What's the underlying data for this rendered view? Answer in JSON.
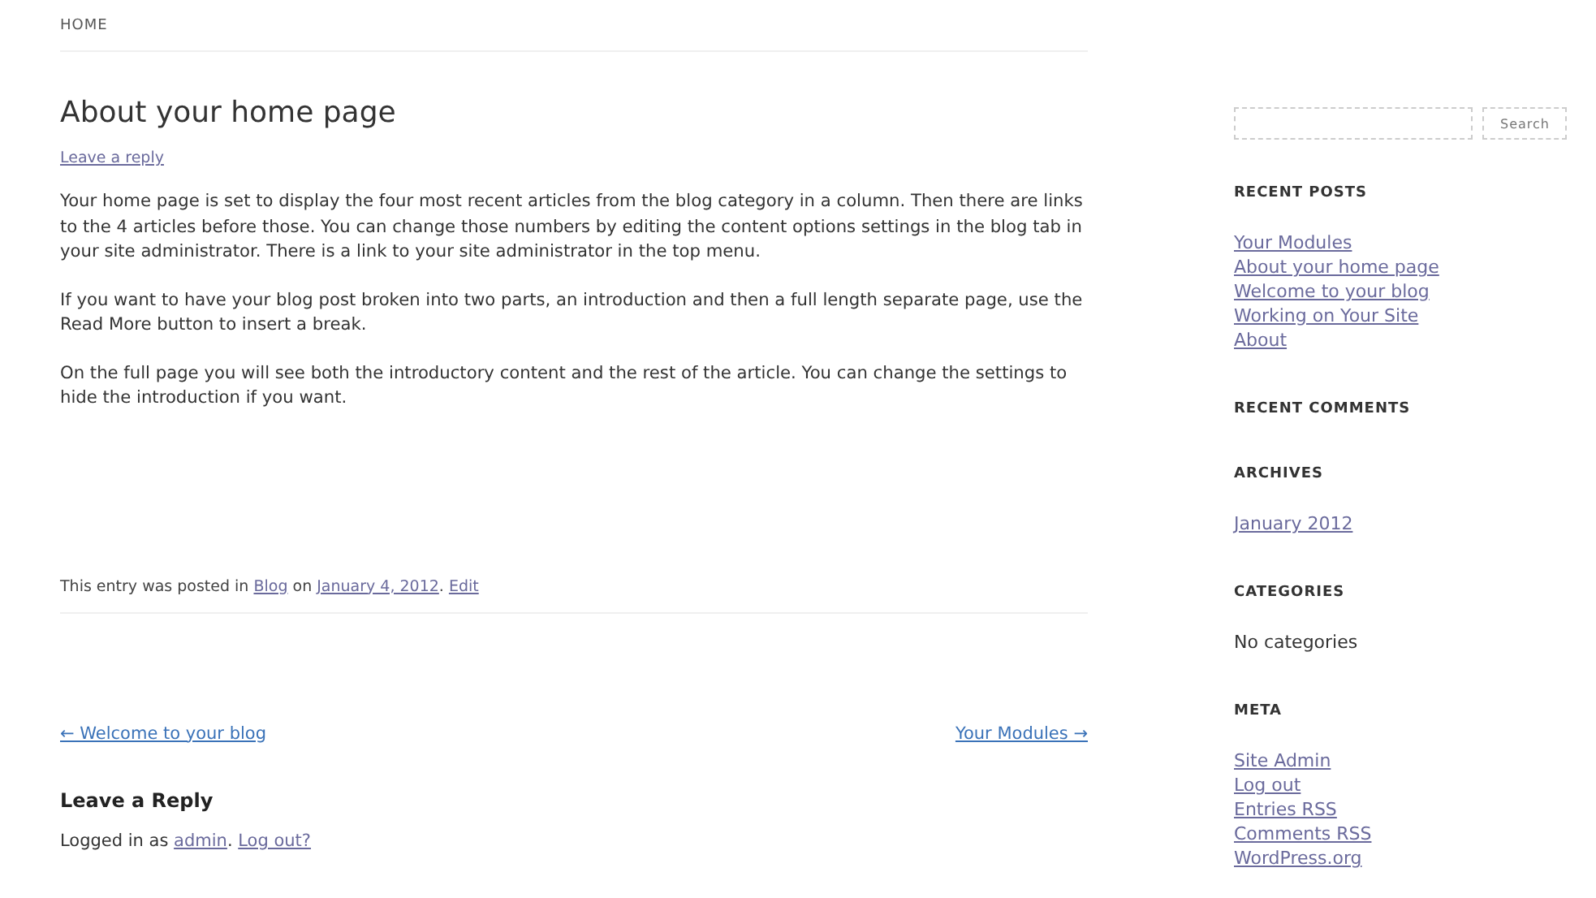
{
  "breadcrumb": "HOME",
  "post": {
    "title": "About your home page",
    "reply_link": "Leave a reply",
    "paragraphs": [
      "Your home page is set to display the four most recent articles from the blog category in a column. Then there are links to the 4 articles before those.  You can change those numbers by editing the content options settings in the blog tab in your site administrator.  There is a link to your site administrator in the top menu.",
      "If you want to have your blog post broken into two parts, an introduction and then a full length separate page, use the Read More button to insert a break.",
      "On the full page you will see both the introductory content and the rest of the article. You can change the settings to hide the introduction if you want."
    ],
    "meta": [
      {
        "kind": "text",
        "text": "This entry was posted in "
      },
      {
        "kind": "link",
        "text": "Blog"
      },
      {
        "kind": "text",
        "text": " on "
      },
      {
        "kind": "link",
        "text": "January 4, 2012"
      },
      {
        "kind": "text",
        "text": ". "
      },
      {
        "kind": "link",
        "text": "Edit"
      }
    ]
  },
  "nav": {
    "previous": "← Welcome to your blog",
    "next": "Your Modules →"
  },
  "reply": {
    "heading": "Leave a Reply",
    "logged_in": [
      {
        "kind": "text",
        "text": "Logged in as "
      },
      {
        "kind": "link",
        "text": "admin"
      },
      {
        "kind": "text",
        "text": ". "
      },
      {
        "kind": "link",
        "text": "Log out?"
      }
    ]
  },
  "sidebar": {
    "search_button": "Search",
    "widgets": [
      {
        "title": "RECENT POSTS",
        "kind": "links",
        "items": [
          "Your Modules",
          "About your home page",
          "Welcome to your blog",
          "Working on Your Site",
          "About"
        ]
      },
      {
        "title": "RECENT COMMENTS"
      },
      {
        "title": "ARCHIVES",
        "kind": "links",
        "items": [
          "January 2012"
        ]
      },
      {
        "title": "CATEGORIES",
        "kind": "text",
        "items": [
          "No categories"
        ]
      },
      {
        "title": "META",
        "kind": "links",
        "items": [
          "Site Admin",
          "Log out",
          "Entries RSS",
          "Comments RSS",
          "WordPress.org"
        ]
      }
    ]
  }
}
